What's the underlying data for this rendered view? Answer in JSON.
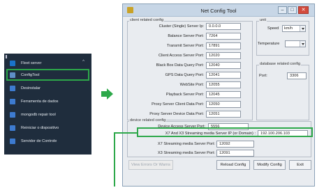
{
  "start_menu": {
    "items": [
      {
        "label": "Fleet server",
        "chevron": "^",
        "icon_color": "#1a73c9"
      },
      {
        "label": "ConfigTool",
        "icon_color": "#5e8fc8"
      },
      {
        "label": "Desinstalar",
        "icon_color": "#3d7bd0"
      },
      {
        "label": "Ferramenta de dados",
        "icon_color": "#3d7bd0"
      },
      {
        "label": "mongodb repair tool",
        "icon_color": "#3d7bd0"
      },
      {
        "label": "Reiniciar o dispositivo",
        "icon_color": "#3d7bd0"
      },
      {
        "label": "Servidor de Controle",
        "icon_color": "#3d7bd0"
      }
    ]
  },
  "window": {
    "title": "Net Config Tool",
    "client_group": "client related config",
    "client_fields": [
      {
        "label": "Cluster (Single) Server Ip:",
        "value": "0.0.0.0"
      },
      {
        "label": "Balance Server Port:",
        "value": "7264"
      },
      {
        "label": "Transmit Server Port:",
        "value": "17891"
      },
      {
        "label": "Client Access Server Port:",
        "value": "12020"
      },
      {
        "label": "Black Box Data Query Port:",
        "value": "12040"
      },
      {
        "label": "GPS Data Query Port:",
        "value": "12041"
      },
      {
        "label": "WebSite Port:",
        "value": "12055"
      },
      {
        "label": "Playback Server Port:",
        "value": "12045"
      },
      {
        "label": "Proxy Server Client Data Port:",
        "value": "12050"
      },
      {
        "label": "Proxy Server Device Data Port:",
        "value": "12051"
      }
    ],
    "unit_group": "unit",
    "speed_label": "Speed",
    "speed_value": "km/h",
    "temperature_label": "Temperature",
    "temperature_value": "",
    "database_group": "database related config",
    "db_port_label": "Port:",
    "db_port_value": "3306",
    "device_group": "device related config",
    "device_fields": [
      {
        "label": "Device Access Server Port:",
        "value": "5556"
      },
      {
        "label": "X7 And X3 Streaming media Server IP (or Domain) :",
        "value": "192.100.206.103"
      },
      {
        "label": "X7 Streaming media Server Port:",
        "value": "12092"
      },
      {
        "label": "X3 Streaming media Server Port:",
        "value": "12091"
      }
    ],
    "buttons": {
      "view_errors": "View Errors Or Warns",
      "reload": "Reload Config",
      "modify": "Modify Config",
      "exit": "Exit"
    }
  },
  "colors": {
    "highlight": "#2da84a",
    "menu_bg": "#1f2d3d"
  }
}
